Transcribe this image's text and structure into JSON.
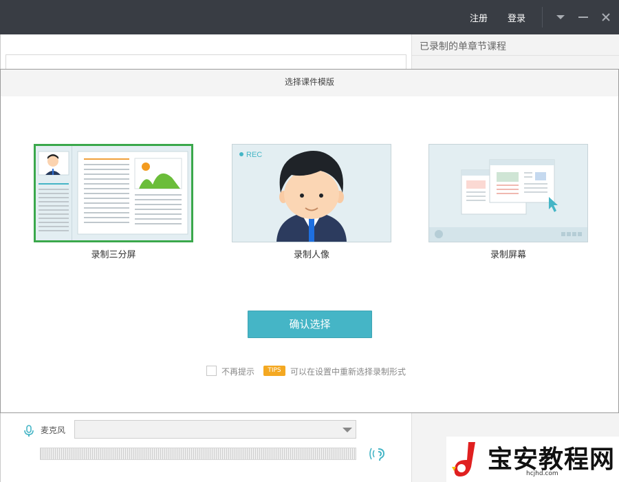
{
  "titlebar": {
    "register_label": "注册",
    "login_label": "登录",
    "bg_color": "#393d44"
  },
  "right_panel": {
    "title": "已录制的单章节课程"
  },
  "dialog": {
    "title": "选择课件模版",
    "templates": [
      {
        "label": "录制三分屏",
        "selected": true,
        "icon": "three-split-screen-illustration"
      },
      {
        "label": "录制人像",
        "selected": false,
        "rec_label": "REC",
        "icon": "portrait-illustration"
      },
      {
        "label": "录制屏幕",
        "selected": false,
        "icon": "screen-recording-illustration"
      }
    ],
    "confirm_label": "确认选择",
    "dont_show_label": "不再提示",
    "tips_badge": "TIPS",
    "tips_text": "可以在设置中重新选择录制形式",
    "accent_color": "#45b5c6",
    "selected_color": "#3aa84b"
  },
  "audio": {
    "mic_label": "麦克风",
    "mic_selected": ""
  },
  "watermark": {
    "text": "宝安教程网",
    "url": "hcjhd.com"
  }
}
